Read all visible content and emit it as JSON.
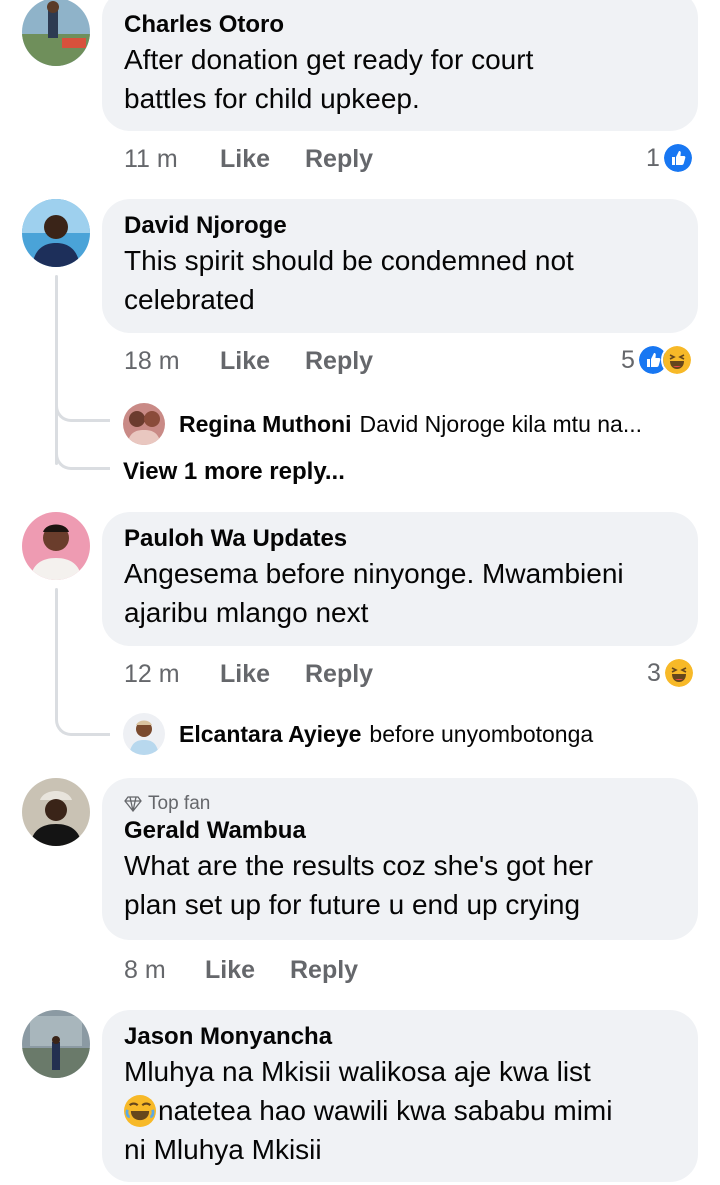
{
  "comments": [
    {
      "author": "Charles Otoro",
      "text_lines": [
        "After donation get ready for court",
        "battles for child upkeep."
      ],
      "time": "11 m",
      "like": "Like",
      "reply": "Reply",
      "reaction_count": "1"
    },
    {
      "author": "David Njoroge",
      "text_lines": [
        "This spirit should be condemned not",
        "celebrated"
      ],
      "time": "18 m",
      "like": "Like",
      "reply": "Reply",
      "reaction_count": "5",
      "replies": [
        {
          "author": "Regina Muthoni",
          "text": "David Njoroge kila mtu na..."
        }
      ],
      "view_more": "View 1 more reply..."
    },
    {
      "author": "Pauloh Wa Updates",
      "text_lines": [
        "Angesema before ninyonge. Mwambieni",
        "ajaribu mlango next"
      ],
      "time": "12 m",
      "like": "Like",
      "reply": "Reply",
      "reaction_count": "3",
      "replies": [
        {
          "author": "Elcantara Ayieye",
          "text": "before unyombotonga"
        }
      ]
    },
    {
      "badge": "Top fan",
      "author": "Gerald Wambua",
      "text_lines": [
        "What are the results coz she's got her",
        "plan set up for future u end up crying"
      ],
      "time": "8 m",
      "like": "Like",
      "reply": "Reply"
    },
    {
      "author": "Jason Monyancha",
      "text_lines": [
        "Mluhya na Mkisii walikosa aje kwa list",
        "natetea hao wawili kwa sababu mimi",
        "ni Mluhya Mkisii"
      ]
    }
  ],
  "colors": {
    "like_blue": "#1877f2",
    "haha_yellow": "#f7b928",
    "bubble_bg": "#f0f2f5",
    "meta_gray": "#65676b"
  },
  "icons": [
    "like-reaction-icon",
    "haha-reaction-icon",
    "top-fan-diamond-icon",
    "laughing-emoji-icon"
  ]
}
